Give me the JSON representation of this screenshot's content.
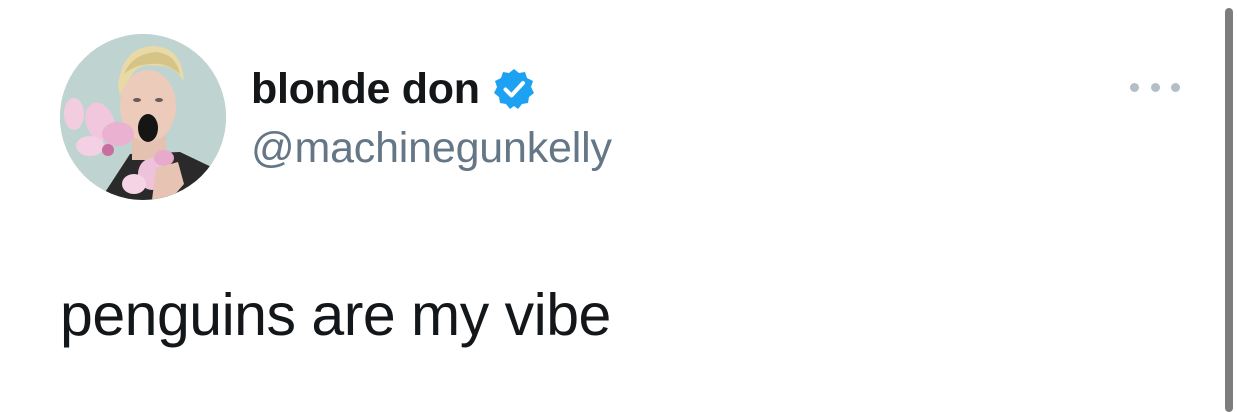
{
  "tweet": {
    "display_name": "blonde don",
    "handle": "@machinegunkelly",
    "text": "penguins are my vibe",
    "verified": true
  },
  "icons": {
    "avatar": "profile-photo",
    "verified": "verified-badge-icon",
    "more": "more-options-icon"
  },
  "colors": {
    "name": "#14171a",
    "handle": "#657786",
    "verified_blue": "#1da1f2",
    "more_dots": "#b3bec7",
    "scrollbar": "#7d7d7d"
  }
}
